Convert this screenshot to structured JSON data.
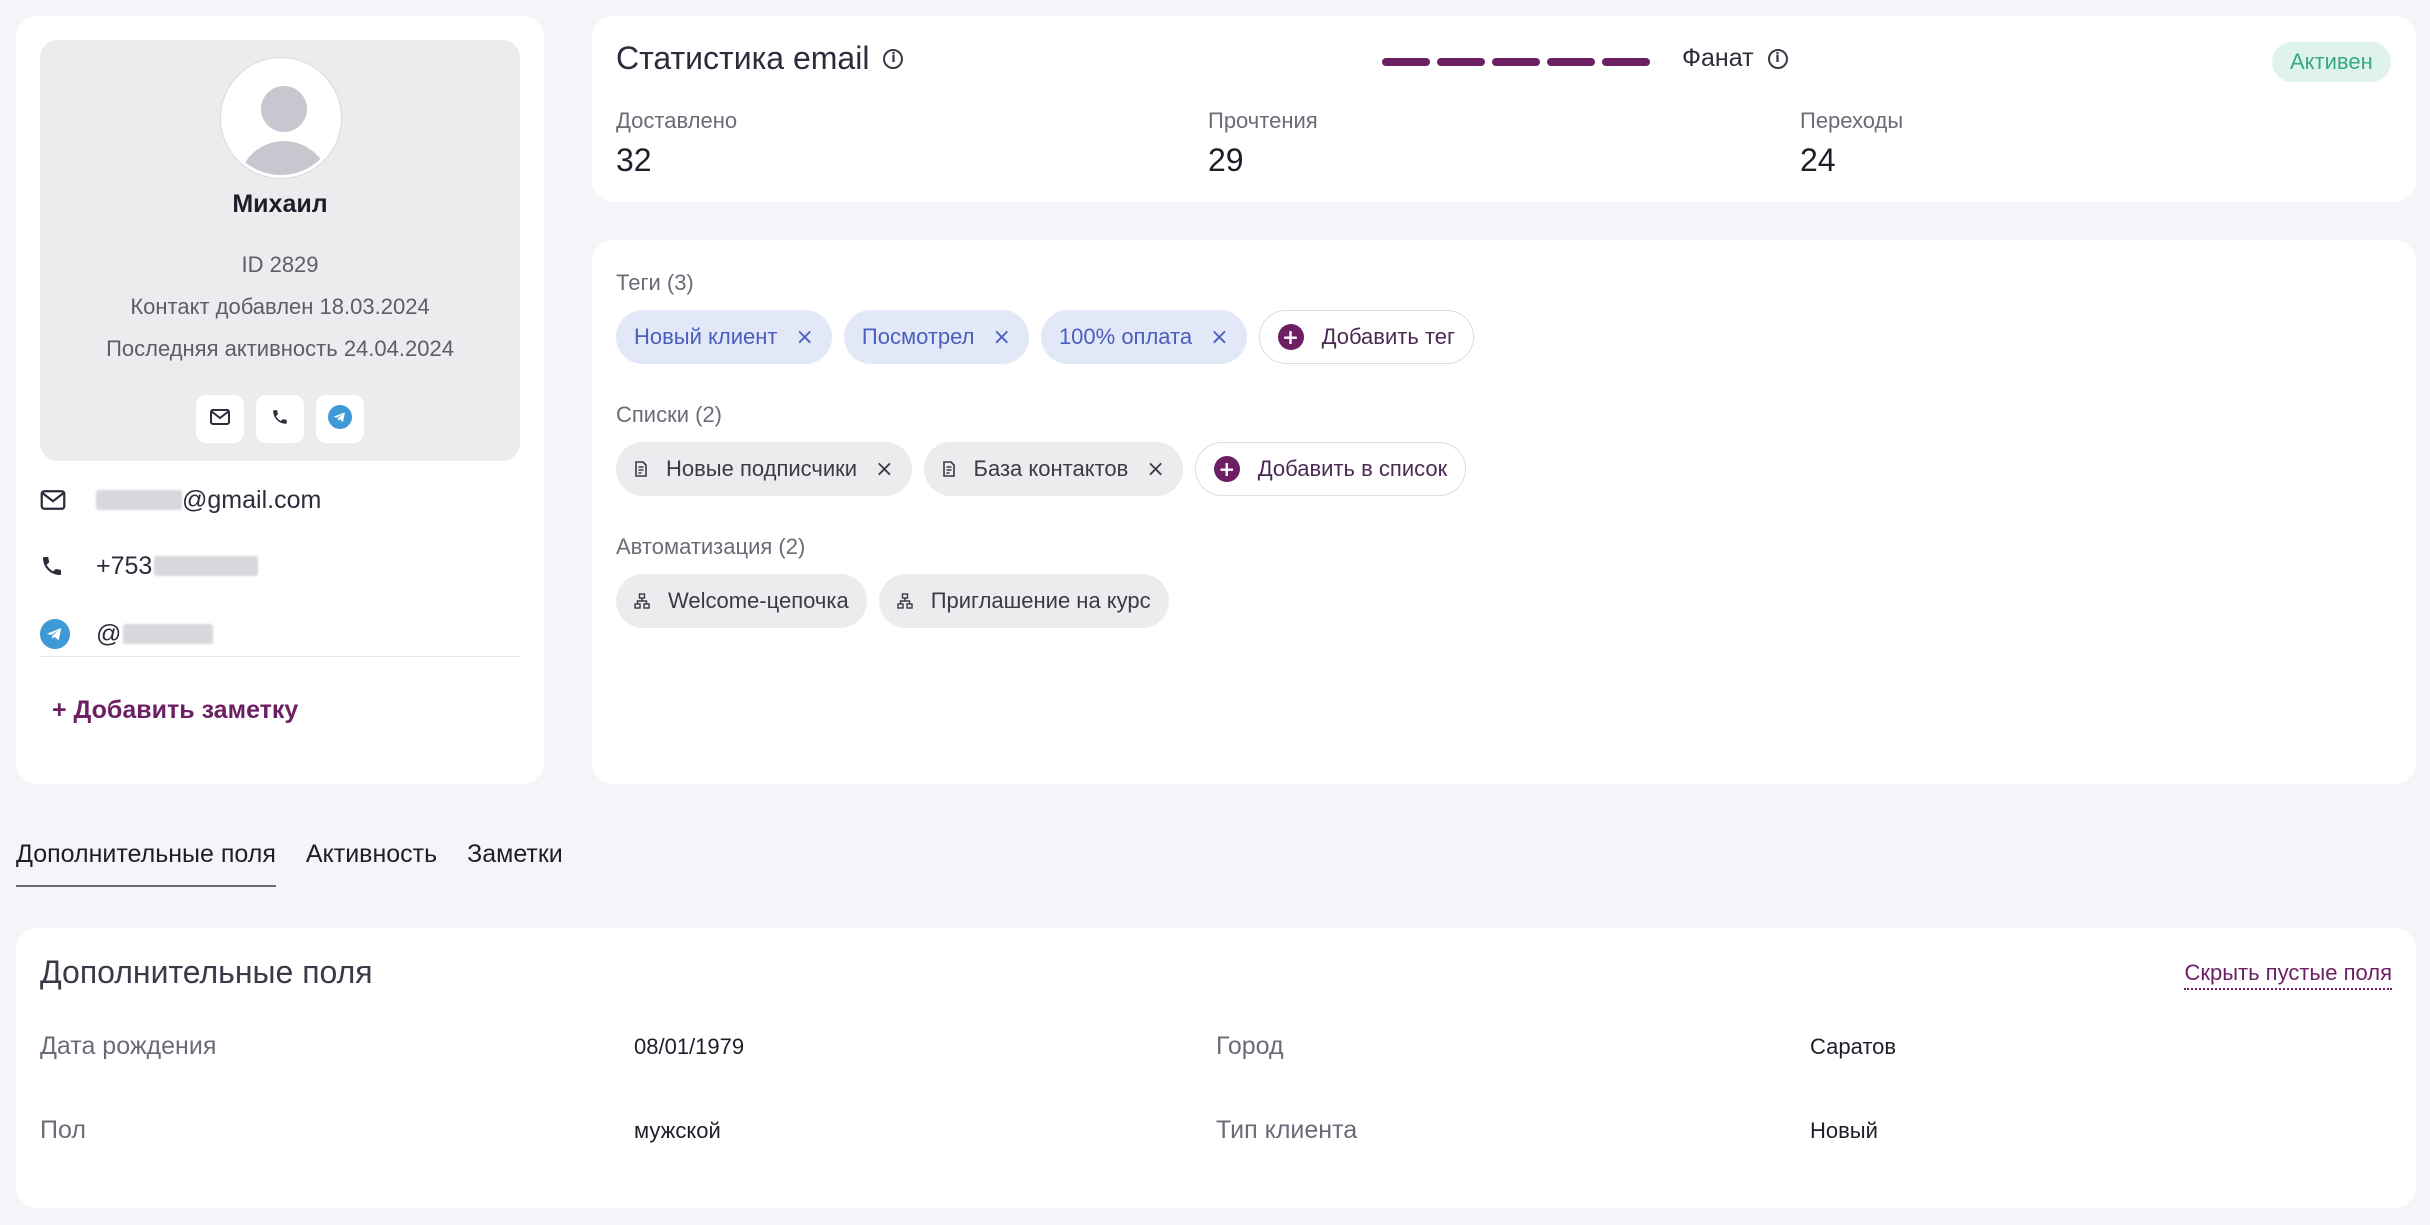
{
  "profile": {
    "name": "Михаил",
    "id_text": "ID 2829",
    "added_text": "Контакт добавлен 18.03.2024",
    "last_activity_text": "Последняя активность 24.04.2024",
    "email_suffix": "@gmail.com",
    "phone_prefix": "+753",
    "telegram_prefix": "@",
    "add_note_label": "+ Добавить заметку"
  },
  "email_stats": {
    "title": "Статистика email",
    "level_label": "Фанат",
    "level_segments_filled": 5,
    "status": "Активен",
    "stats": [
      {
        "label": "Доставлено",
        "value": "32"
      },
      {
        "label": "Прочтения",
        "value": "29"
      },
      {
        "label": "Переходы",
        "value": "24"
      }
    ]
  },
  "tags": {
    "label": "Теги (3)",
    "items": [
      "Новый клиент",
      "Посмотрел",
      "100% оплата"
    ],
    "add_label": "Добавить тег"
  },
  "lists": {
    "label": "Списки (2)",
    "items": [
      "Новые подписчики",
      "База контактов"
    ],
    "add_label": "Добавить в список"
  },
  "automations": {
    "label": "Автоматизация (2)",
    "items": [
      "Welcome-цепочка",
      "Приглашение на курс"
    ]
  },
  "tabs": [
    "Дополнительные поля",
    "Активность",
    "Заметки"
  ],
  "fields": {
    "title": "Дополнительные поля",
    "hide_empty_label": "Скрыть пустые поля",
    "rows": [
      {
        "label": "Дата рождения",
        "value": "08/01/1979"
      },
      {
        "label": "Город",
        "value": "Саратов"
      },
      {
        "label": "Пол",
        "value": "мужской"
      },
      {
        "label": "Тип клиента",
        "value": "Новый"
      }
    ]
  },
  "colors": {
    "accent": "#6d1f63",
    "tag_bg": "#e3e8f8",
    "tag_text": "#4a5fbd",
    "status_bg": "#dff3ec",
    "status_text": "#3aa982",
    "telegram": "#3d9ad6"
  }
}
